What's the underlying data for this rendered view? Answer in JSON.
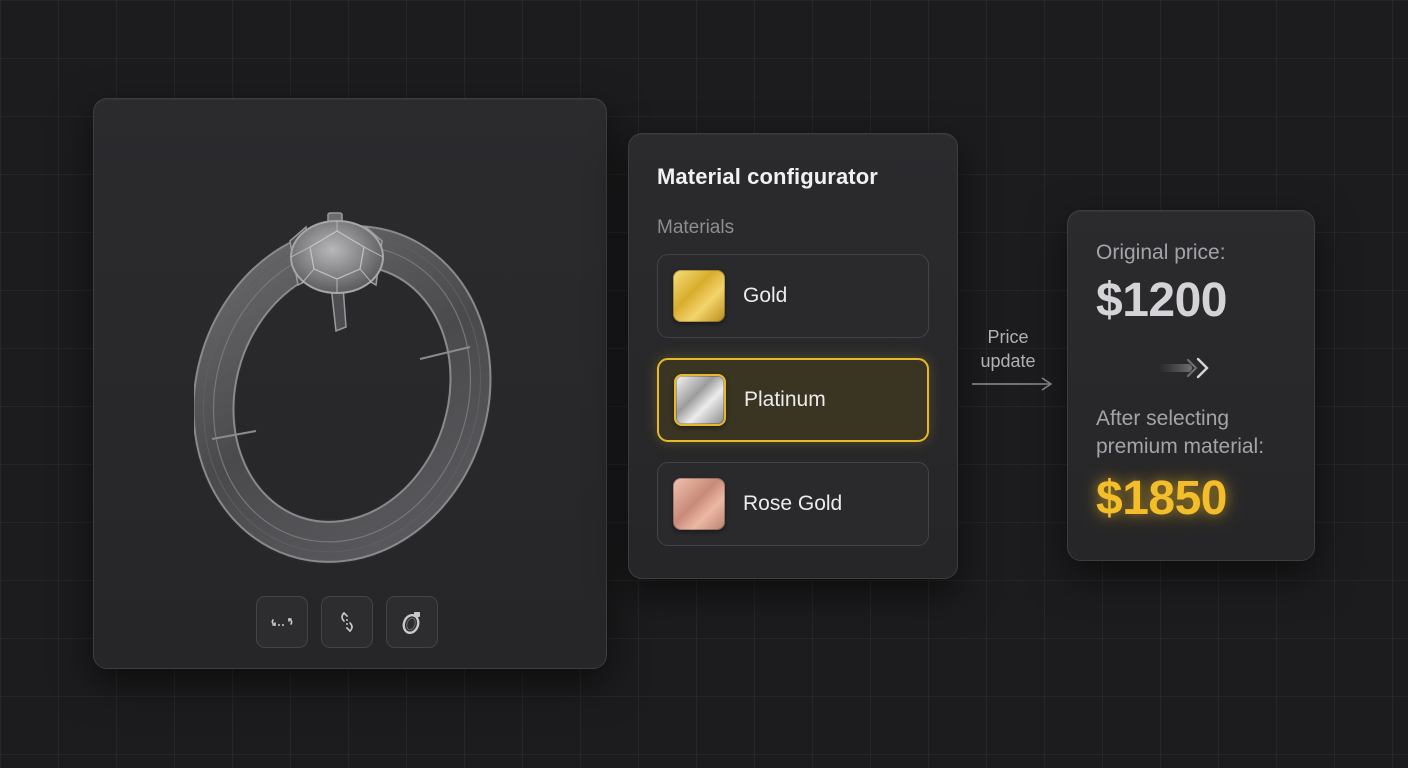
{
  "viewer": {
    "controls": [
      {
        "icon": "rotate-horizontal-icon"
      },
      {
        "icon": "rotate-vertical-icon"
      },
      {
        "icon": "ring-view-icon"
      }
    ]
  },
  "configurator": {
    "title": "Material configurator",
    "section_label": "Materials",
    "materials": [
      {
        "label": "Gold",
        "swatch_color": "#e0b93e",
        "selected": false
      },
      {
        "label": "Platinum",
        "swatch_color": "#c8c8c8",
        "selected": true
      },
      {
        "label": "Rose Gold",
        "swatch_color": "#d9a08d",
        "selected": false
      }
    ],
    "accent_color": "#e6b82b"
  },
  "connector": {
    "line1": "Price",
    "line2": "update"
  },
  "price": {
    "original_label": "Original price:",
    "original_value": "$1200",
    "after_label_line1": "After selecting",
    "after_label_line2": "premium material:",
    "new_value": "$1850",
    "new_value_color": "#f4be2a"
  }
}
